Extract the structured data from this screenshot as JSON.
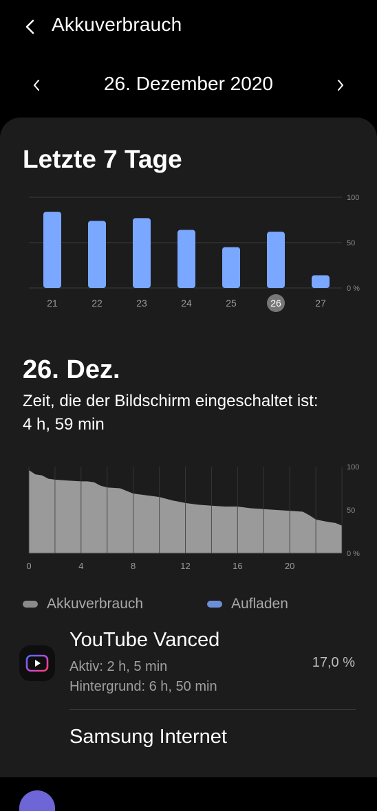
{
  "header": {
    "title": "Akkuverbrauch",
    "back_icon": "chevron-left-icon"
  },
  "datebar": {
    "date": "26. Dezember 2020",
    "prev_icon": "chevron-left-icon",
    "next_icon": "chevron-right-icon"
  },
  "week": {
    "title": "Letzte 7 Tage",
    "chart_data": {
      "type": "bar",
      "categories": [
        "21",
        "22",
        "23",
        "24",
        "25",
        "26",
        "27"
      ],
      "values": [
        84,
        74,
        77,
        64,
        45,
        62,
        14
      ],
      "selected": "26",
      "yticks": [
        "100",
        "50",
        "0 %"
      ],
      "ylim": [
        0,
        100
      ],
      "bar_color": "#7aa7ff"
    }
  },
  "day": {
    "title": "26. Dez.",
    "screen_label": "Zeit, die der Bildschirm eingeschaltet ist:",
    "screen_value": "4 h, 59 min",
    "chart_data": {
      "type": "area",
      "x": [
        0,
        0.5,
        1,
        1.5,
        2,
        3,
        4,
        4.5,
        5,
        5.5,
        6,
        7,
        8,
        9,
        10,
        11,
        12,
        13,
        14,
        15,
        16,
        17,
        18,
        19,
        20,
        21,
        21.5,
        22,
        23,
        23.5,
        24
      ],
      "values": [
        96,
        91,
        90,
        86,
        85,
        84,
        83,
        83,
        82,
        78,
        76,
        75,
        69,
        67,
        65,
        61,
        58,
        56,
        55,
        54,
        54,
        52,
        51,
        50,
        49,
        48,
        44,
        39,
        36,
        35,
        32
      ],
      "xticks": [
        "0",
        "4",
        "8",
        "12",
        "16",
        "20"
      ],
      "yticks": [
        "100",
        "50",
        "0 %"
      ],
      "ylim": [
        0,
        100
      ],
      "xlim": [
        0,
        24
      ],
      "fill_color": "#9a9a9a"
    },
    "legend": [
      {
        "label": "Akkuverbrauch",
        "color": "#8a8a8a"
      },
      {
        "label": "Aufladen",
        "color": "#6b8fd8"
      }
    ]
  },
  "apps": [
    {
      "name": "YouTube Vanced",
      "active": "Aktiv: 2 h, 5 min",
      "background": "Hintergrund: 6 h, 50 min",
      "percent": "17,0 %",
      "icon": "youtube-vanced-icon"
    },
    {
      "name": "Samsung Internet",
      "icon": "samsung-internet-icon"
    }
  ]
}
